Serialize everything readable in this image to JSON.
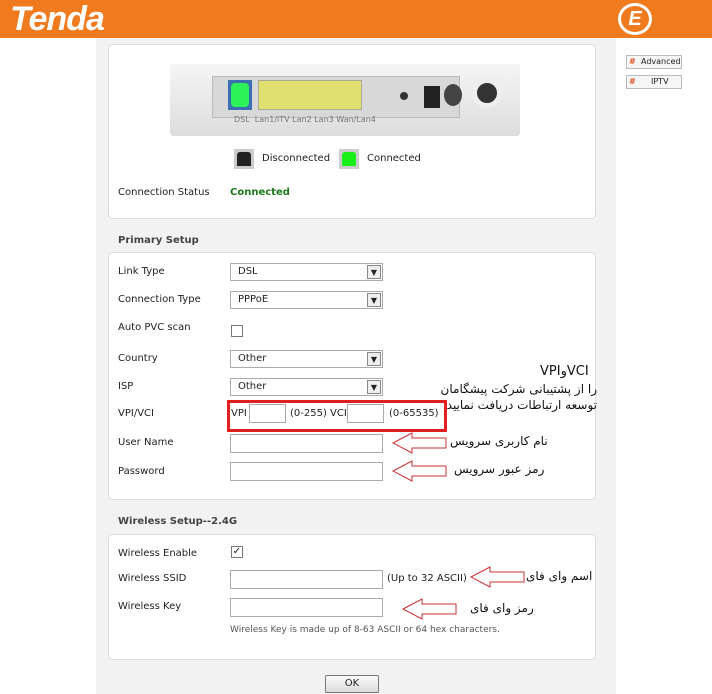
{
  "header": {
    "logo": "Tenda",
    "brand_mark": "E"
  },
  "side": {
    "advanced": "Advanced",
    "iptv": "IPTV"
  },
  "device": {
    "ports": [
      "DSL",
      "Lan1/iTV",
      "Lan2",
      "Lan3",
      "Wan/Lan4"
    ]
  },
  "legend": {
    "disconnected": "Disconnected",
    "connected": "Connected"
  },
  "status": {
    "label": "Connection Status",
    "value": "Connected"
  },
  "primary": {
    "title": "Primary Setup",
    "link_type": {
      "label": "Link Type",
      "value": "DSL"
    },
    "connection_type": {
      "label": "Connection Type",
      "value": "PPPoE"
    },
    "auto_pvc": {
      "label": "Auto PVC scan",
      "checked": false
    },
    "country": {
      "label": "Country",
      "value": "Other"
    },
    "isp": {
      "label": "ISP",
      "value": "Other"
    },
    "vpivci": {
      "label": "VPI/VCI",
      "vpi": "VPI",
      "vpi_range": "(0-255)",
      "vci": "VCI",
      "vci_range": "(0-65535)",
      "vpi_value": "",
      "vci_value": ""
    },
    "username": {
      "label": "User Name",
      "value": ""
    },
    "password": {
      "label": "Password",
      "value": ""
    }
  },
  "wireless": {
    "title": "Wireless Setup--2.4G",
    "enable": {
      "label": "Wireless Enable",
      "checked": true
    },
    "ssid": {
      "label": "Wireless SSID",
      "value": "",
      "hint": "(Up to 32 ASCII)"
    },
    "key": {
      "label": "Wireless Key",
      "value": "",
      "hint": "Wireless Key is made up of 8-63 ASCII or 64 hex characters."
    }
  },
  "ok": "OK",
  "annotations": {
    "vpi_title": "VPIوVCI",
    "vpi_line1": "را از پشتیبانی شرکت پیشگامان",
    "vpi_line2": "توسعه ارتباطات دریافت نمایید",
    "username": "نام کاربری سرویس",
    "password": "رمز عبور سرویس",
    "ssid": "اسم وای فای",
    "key": "رمز وای فای"
  },
  "colors": {
    "header": "#f07a1e",
    "connected": "#1a7a1a",
    "highlight": "#e02020"
  }
}
